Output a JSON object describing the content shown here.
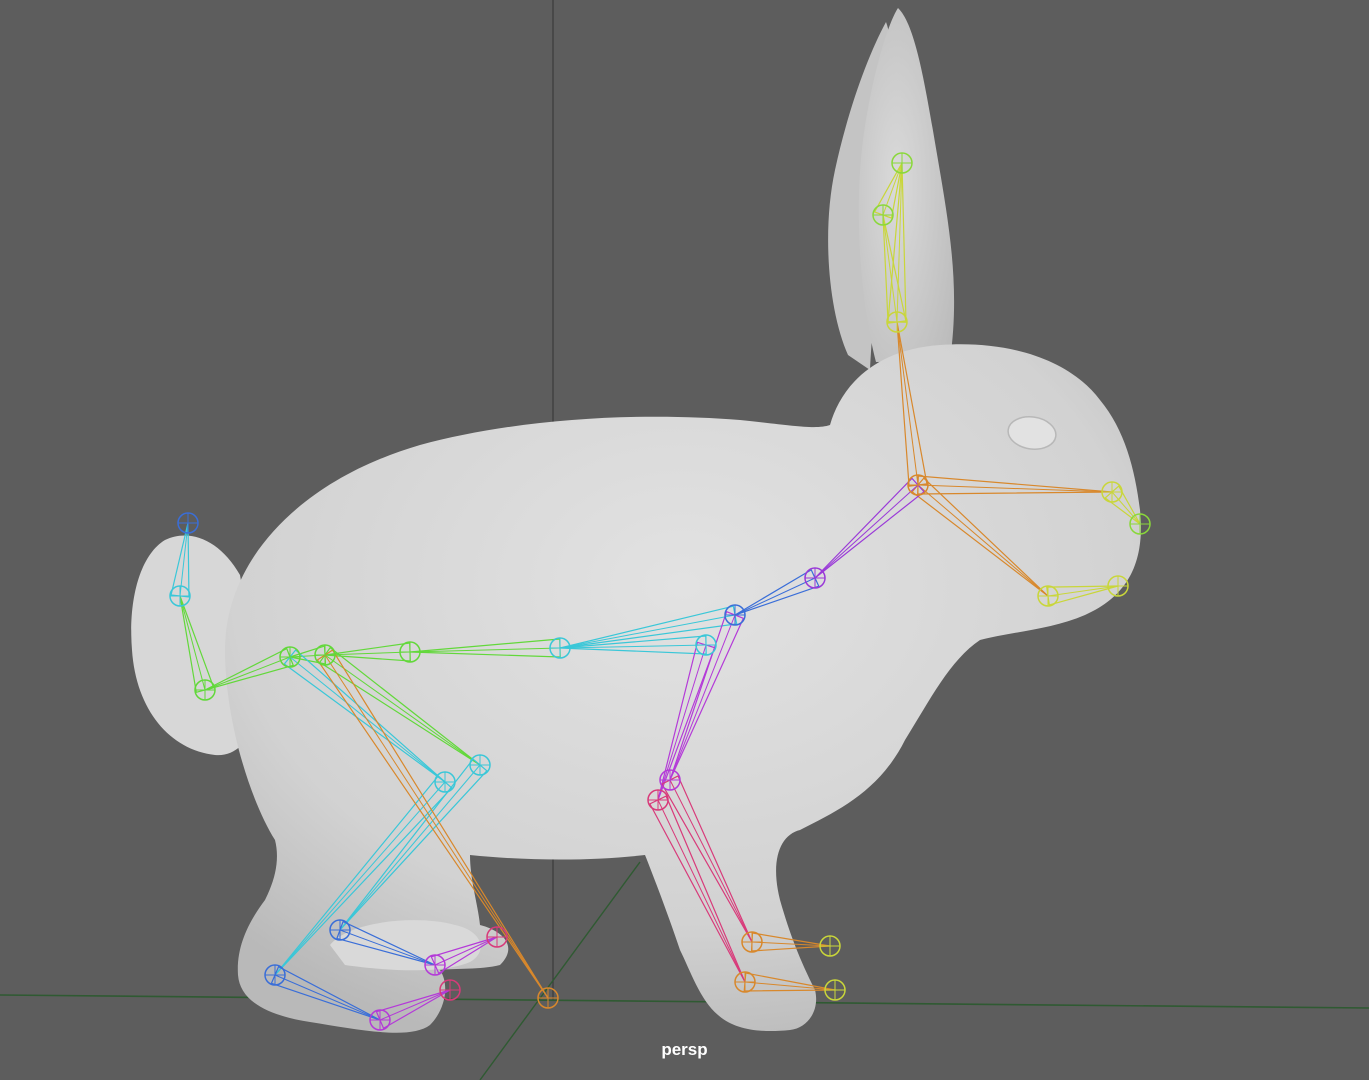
{
  "viewport": {
    "camera_label": "persp",
    "background_color": "#5d5d5d",
    "grid_color": "#2f5a32",
    "mesh_color": "#d3d3d3"
  },
  "model": {
    "kind": "rabbit-mesh",
    "skeleton_colors": {
      "ear": "#c9d63a",
      "ear_tip": "#8ad83a",
      "head": "#d8882c",
      "neck": "#9a3ad8",
      "spine": "#3ac7d8",
      "tail": "#46b8c9",
      "hip": "#62d83a",
      "hind_leg": "#3aa6d8",
      "hind_foot": "#3a6ed8",
      "toe": "#b43ad8",
      "toe_tip": "#d83a7a",
      "knee_ik": "#d8882c",
      "front_leg": "#b43ad8",
      "front_lower": "#d83a7a",
      "front_foot": "#d8882c",
      "front_toe": "#c9d63a"
    }
  }
}
